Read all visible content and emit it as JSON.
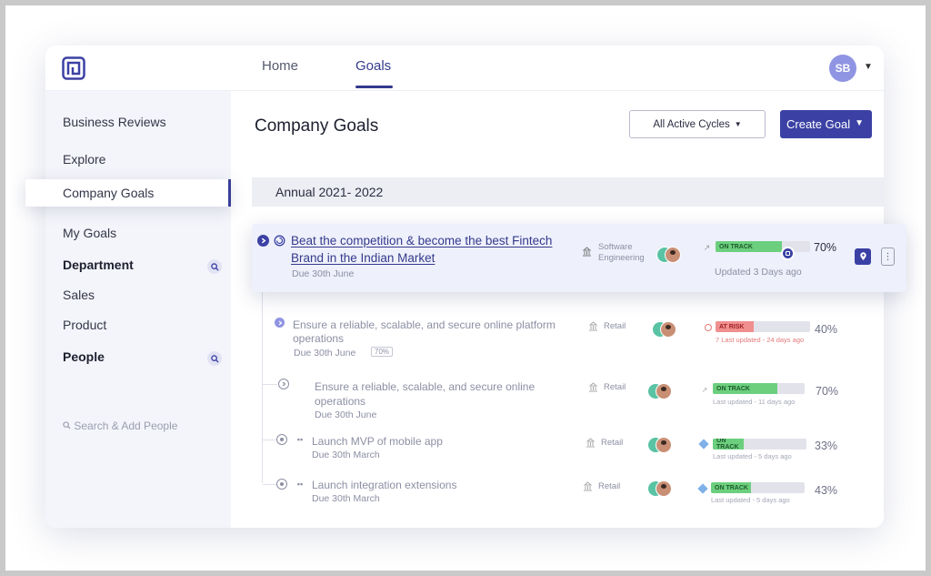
{
  "nav": {
    "home": "Home",
    "goals": "Goals",
    "user_initials": "SB"
  },
  "sidebar": {
    "business_reviews": "Business Reviews",
    "explore": "Explore",
    "company_goals": "Company Goals",
    "my_goals": "My Goals",
    "department": "Department",
    "sales": "Sales",
    "product": "Product",
    "people": "People",
    "search_people_placeholder": "Search & Add People"
  },
  "main": {
    "title": "Company Goals",
    "cycles_button": "All Active Cycles",
    "create_button": "Create Goal",
    "cycle_label": "Annual 2021- 2022"
  },
  "goals": [
    {
      "title_line1": "Beat the competition & become the best Fintech",
      "title_line2": "Brand in the Indian Market",
      "due": "Due 30th June",
      "dept_line1": "Software",
      "dept_line2": "Engineering",
      "status": "ON TRACK",
      "progress": 70,
      "progress_label": "70%",
      "updated": "Updated 3 Days ago"
    },
    {
      "title_line1": "Ensure a reliable, scalable, and secure online platform",
      "title_line2": "operations",
      "due": "Due 30th June",
      "badge": "70%",
      "dept": "Retail",
      "status": "AT RISK",
      "progress": 40,
      "progress_label": "40%",
      "updated": "7 Last updated - 24 days ago"
    },
    {
      "title_line1": "Ensure a reliable, scalable, and secure online",
      "title_line2": "operations",
      "due": "Due 30th June",
      "dept": "Retail",
      "status": "ON TRACK",
      "progress": 70,
      "progress_label": "70%",
      "updated": "Last updated - 11 days ago"
    },
    {
      "title_line1": "Launch MVP of mobile app",
      "due": "Due 30th March",
      "dept": "Retail",
      "status": "ON TRACK",
      "progress": 33,
      "progress_label": "33%",
      "updated": "Last updated - 5 days ago"
    },
    {
      "title_line1": "Launch integration extensions",
      "due": "Due 30th March",
      "dept": "Retail",
      "status": "ON TRACK",
      "progress": 43,
      "progress_label": "43%",
      "updated": "Last updated - 5 days ago"
    }
  ],
  "colors": {
    "brand": "#3b41a4",
    "on_track": "#6ccf7e",
    "at_risk": "#f08f8f",
    "sidebar_bg": "#f4f5fa"
  },
  "icons": {
    "logo": "app-logo-icon",
    "search": "search-icon",
    "chevron": "chevron-down-icon",
    "expand": "expand-arrow-icon",
    "target": "target-icon",
    "building": "building-icon",
    "kebab": "kebab-menu-icon"
  }
}
